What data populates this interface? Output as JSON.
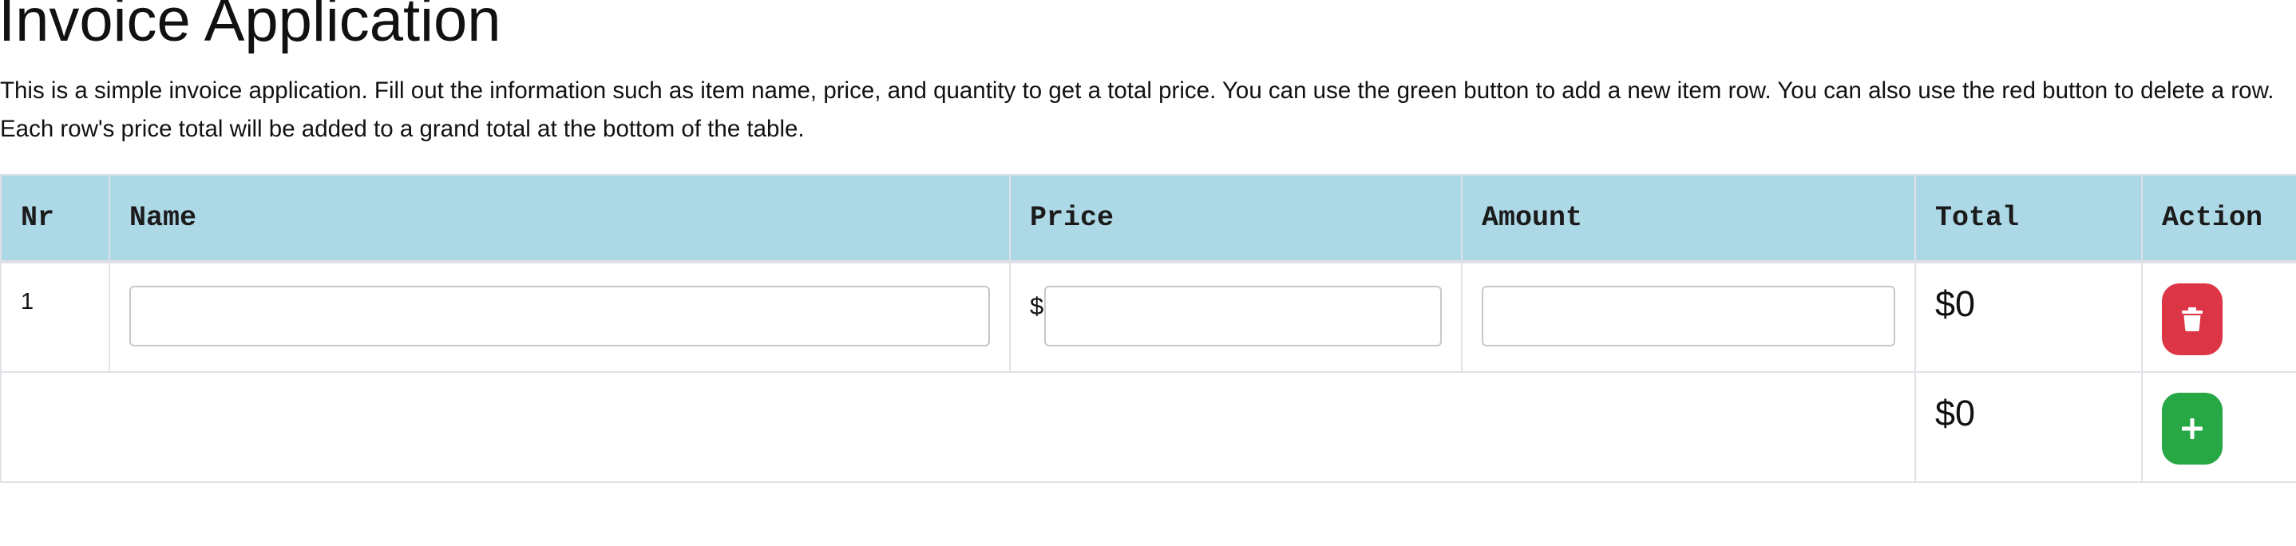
{
  "page": {
    "title": "Invoice Application",
    "description": "This is a simple invoice application. Fill out the information such as item name, price, and quantity to get a total price. You can use the green button to add a new item row. You can also use the red button to delete a row. Each row's price total will be added to a grand total at the bottom of the table."
  },
  "table": {
    "headers": {
      "nr": "Nr",
      "name": "Name",
      "price": "Price",
      "amount": "Amount",
      "total": "Total",
      "action": "Action"
    },
    "rows": [
      {
        "nr": "1",
        "name_value": "",
        "currency_symbol": "$",
        "price_value": "",
        "amount_value": "",
        "total": "$0",
        "action_icon": "trash-icon"
      }
    ],
    "footer": {
      "grand_total": "$0",
      "action_icon": "plus-icon"
    }
  },
  "colors": {
    "header_background": "#add8e6",
    "delete_button": "#dc3545",
    "add_button": "#28a745",
    "border": "#dee2e6"
  }
}
